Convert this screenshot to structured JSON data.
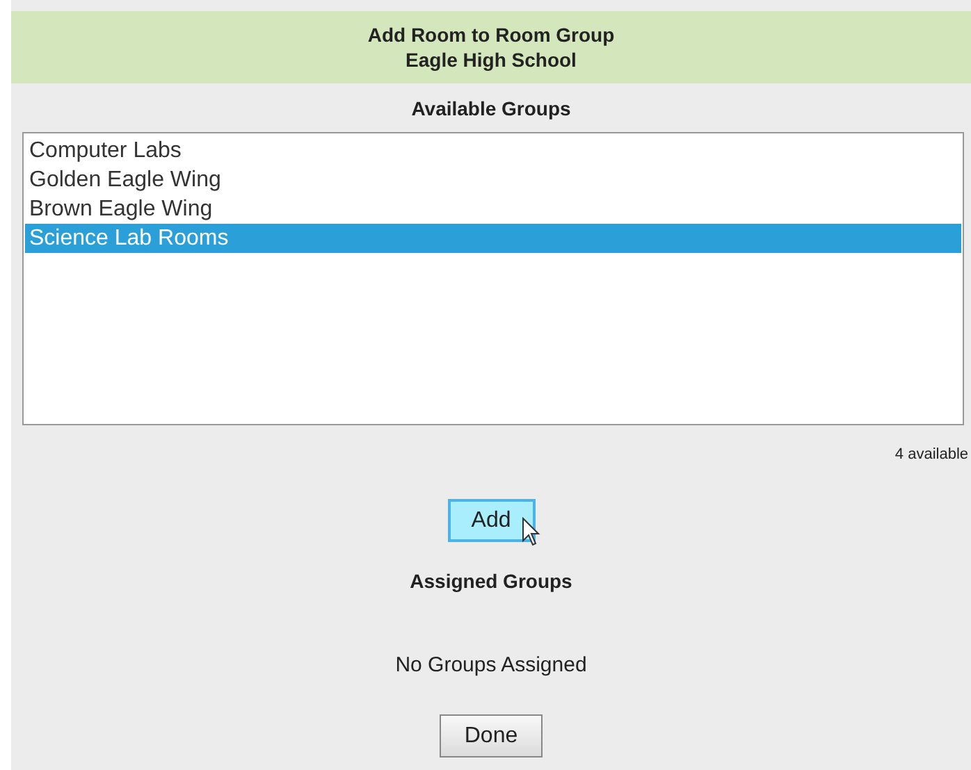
{
  "header": {
    "title": "Add Room to Room Group",
    "subtitle": "Eagle High School"
  },
  "available": {
    "heading": "Available Groups",
    "items": [
      {
        "label": "Computer Labs",
        "selected": false
      },
      {
        "label": "Golden Eagle Wing",
        "selected": false
      },
      {
        "label": "Brown Eagle Wing",
        "selected": false
      },
      {
        "label": "Science Lab Rooms",
        "selected": true
      }
    ],
    "count": "4 available"
  },
  "add_button": {
    "label": "Add",
    "hovered": true
  },
  "assigned": {
    "heading": "Assigned Groups",
    "empty_text": "No Groups Assigned"
  },
  "done_button": {
    "label": "Done"
  }
}
